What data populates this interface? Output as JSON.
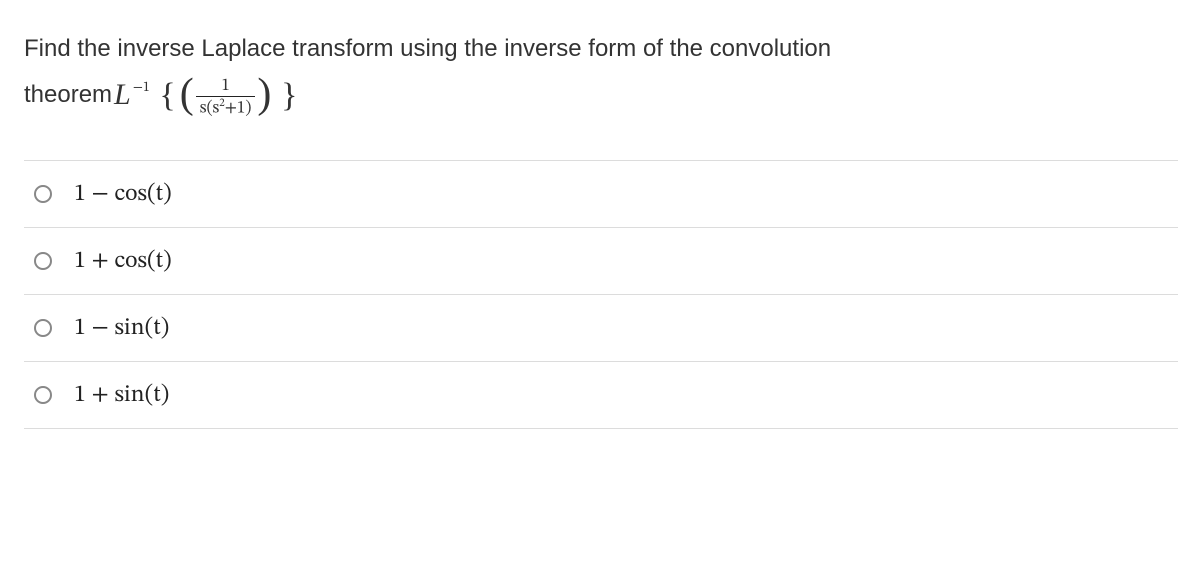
{
  "question": {
    "line1_part_a": "Find the inverse Laplace transform using the inverse form of the convolution",
    "line2_prefix": "theorem ",
    "operator_symbol": "L",
    "exponent": "−1",
    "frac_num": "1",
    "frac_den_s": "s",
    "frac_den_open": "(",
    "frac_den_var": "s",
    "frac_den_exp": "2",
    "frac_den_plus": "+1",
    "frac_den_close": ")",
    "brace_open": "{",
    "brace_close": "}",
    "paren_open": "(",
    "paren_close": ")"
  },
  "options": [
    {
      "label": "1 − cos(t)"
    },
    {
      "label": "1 + cos(t)"
    },
    {
      "label": "1 − sin(t)"
    },
    {
      "label": "1 + sin(t)"
    }
  ]
}
